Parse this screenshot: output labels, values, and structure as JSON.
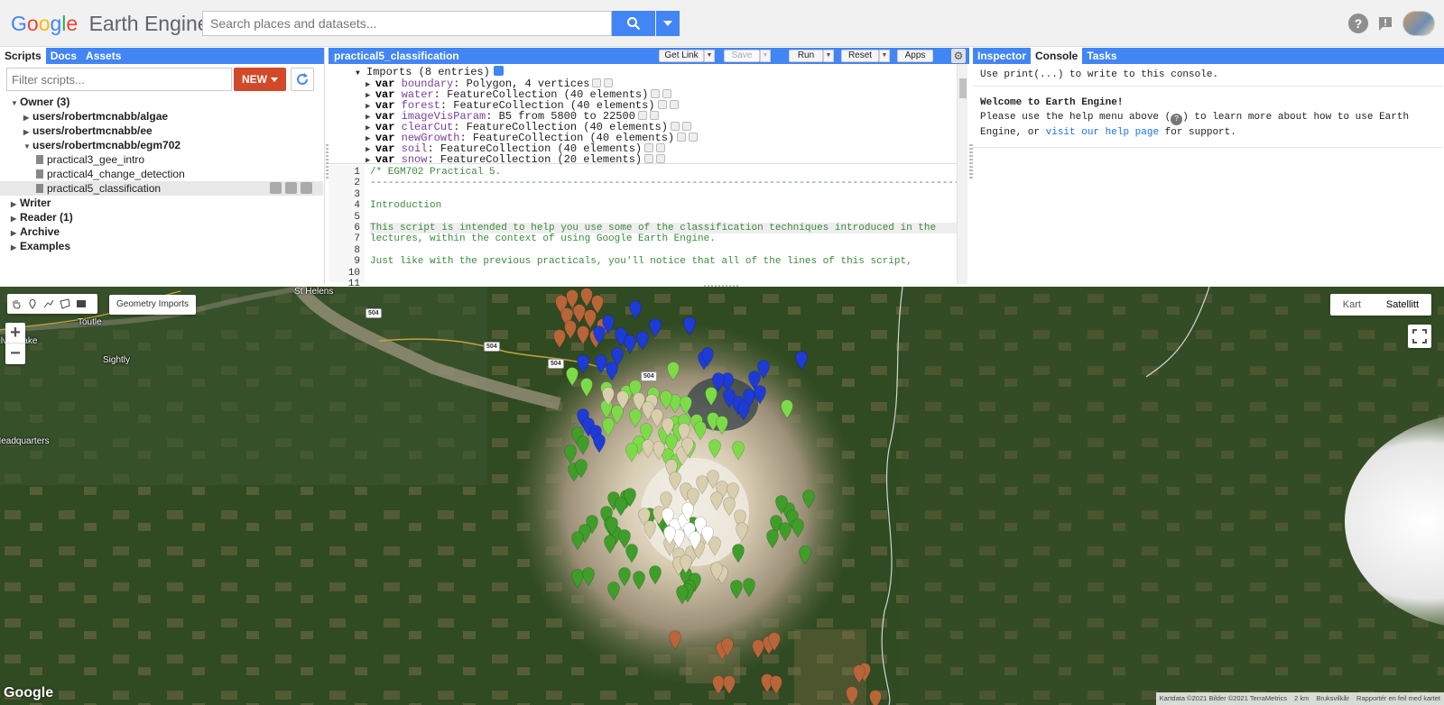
{
  "header": {
    "logo_google": "Google",
    "logo_product": "Earth Engine",
    "search_placeholder": "Search places and datasets...",
    "icons": [
      "search-icon",
      "help-icon",
      "feedback-icon",
      "avatar"
    ]
  },
  "left_panel": {
    "tabs": [
      "Scripts",
      "Docs",
      "Assets"
    ],
    "active_tab": "Scripts",
    "filter_placeholder": "Filter scripts...",
    "new_label": "NEW",
    "tree": [
      {
        "label": "Owner",
        "count": "(3)",
        "level": 0,
        "expanded": true,
        "bold": true
      },
      {
        "label": "users/robertmcnabb/algae",
        "level": 1,
        "expanded": false,
        "bold": true
      },
      {
        "label": "users/robertmcnabb/ee",
        "level": 1,
        "expanded": false,
        "bold": true
      },
      {
        "label": "users/robertmcnabb/egm702",
        "level": 1,
        "expanded": true,
        "bold": true
      },
      {
        "label": "practical3_gee_intro",
        "level": 2,
        "file": true
      },
      {
        "label": "practical4_change_detection",
        "level": 2,
        "file": true
      },
      {
        "label": "practical5_classification",
        "level": 2,
        "file": true,
        "selected": true
      },
      {
        "label": "Writer",
        "level": 0,
        "expanded": false,
        "bold": true
      },
      {
        "label": "Reader",
        "count": "(1)",
        "level": 0,
        "expanded": false,
        "bold": true
      },
      {
        "label": "Archive",
        "level": 0,
        "expanded": false,
        "bold": true
      },
      {
        "label": "Examples",
        "level": 0,
        "expanded": false,
        "bold": true
      }
    ]
  },
  "editor": {
    "file_title": "practical5_classification",
    "buttons": {
      "get_link": "Get Link",
      "save": "Save",
      "run": "Run",
      "reset": "Reset",
      "apps": "Apps"
    },
    "imports_header": "Imports (8 entries)",
    "imports": [
      {
        "name": "boundary",
        "value": "Polygon, 4 vertices"
      },
      {
        "name": "water",
        "value": "FeatureCollection (40 elements)"
      },
      {
        "name": "forest",
        "value": "FeatureCollection (40 elements)"
      },
      {
        "name": "imageVisParam",
        "value": "B5 from 5800 to 22500"
      },
      {
        "name": "clearCut",
        "value": "FeatureCollection (40 elements)"
      },
      {
        "name": "newGrowth",
        "value": "FeatureCollection (40 elements)"
      },
      {
        "name": "soil",
        "value": "FeatureCollection (40 elements)"
      },
      {
        "name": "snow",
        "value": "FeatureCollection (20 elements)"
      }
    ],
    "keyword": "var",
    "line_numbers": [
      "1",
      "2",
      "3",
      "4",
      "5",
      "6",
      "7",
      "8",
      "9",
      "10",
      "11"
    ],
    "code_lines": [
      "/* EGM702 Practical 5.",
      "-----------------------------------------------------------------------------------------------------",
      "",
      "Introduction",
      "",
      "This script is intended to help you use some of the classification techniques introduced in the",
      "lectures, within the context of using Google Earth Engine.",
      "",
      "Just like with the previous practicals, you'll notice that all of the lines of this script,",
      "",
      ""
    ],
    "highlighted_line": 6
  },
  "right_panel": {
    "tabs": [
      "Inspector",
      "Console",
      "Tasks"
    ],
    "active_tab": "Console",
    "hint": "Use print(...) to write to this console.",
    "welcome": "Welcome to Earth Engine!",
    "help_pre": "Please use the help menu above (",
    "help_mid": ") to learn more about how to use Earth Engine, or ",
    "help_link": "visit our help page",
    "help_post": " for support."
  },
  "map": {
    "geometry_imports_label": "Geometry Imports",
    "map_types": [
      "Kart",
      "Satellitt"
    ],
    "active_map_type": "Satellitt",
    "zoom_in": "+",
    "zoom_out": "−",
    "places": [
      "St Helens",
      "Toutle",
      "Silver Lake",
      "Sightly",
      "Headquarters"
    ],
    "roads": [
      "504",
      "504",
      "504",
      "504"
    ],
    "google_logo": "Google",
    "attribution": [
      "Kartdata ©2021 Bilder ©2021 TerraMetrics",
      "2 km",
      "Bruksvilkår",
      "Rapportér en feil med kartet"
    ],
    "marker_colors": {
      "clearCut": "#b8653a",
      "water": "#1e3bd6",
      "newGrowth": "#7ddb4a",
      "forest": "#3f9d2a",
      "soil": "#d9cfae",
      "snow": "#ffffff"
    }
  }
}
